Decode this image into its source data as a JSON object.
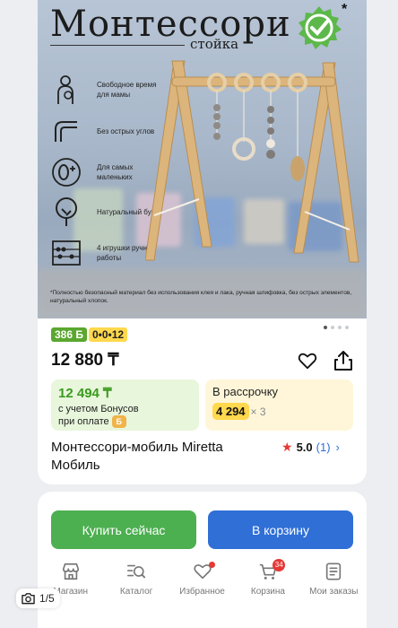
{
  "hero": {
    "brand": "Монтессори",
    "subtitle": "стойка",
    "seal_mark": "*",
    "features": [
      {
        "icon": "mother-child-icon",
        "text": "Свободное время для мамы"
      },
      {
        "icon": "rounded-corner-icon",
        "text": "Без острых углов"
      },
      {
        "icon": "zero-plus-icon",
        "text": "Для самых маленьких"
      },
      {
        "icon": "tree-icon",
        "text": "Натуральный бук"
      },
      {
        "icon": "abacus-icon",
        "text": "4 игрушки ручной работы"
      }
    ],
    "note": "*Полностью безопасный материал без использования клея и лака, ручная шлифовка, без острых элементов, натуральный хлопок."
  },
  "tags": {
    "bonus": "386 Б",
    "installment": "0•0•12"
  },
  "price": "12 880 ₸",
  "bonus_box": {
    "price": "12 494 ₸",
    "line1": "с учетом Бонусов",
    "line2": "при оплате",
    "coin": "Б"
  },
  "installment_box": {
    "title": "В рассрочку",
    "amount": "4 294",
    "times": "× 3"
  },
  "title": "Монтессори-мобиль Miretta Мобиль",
  "rating": {
    "score": "5.0",
    "count": "(1)"
  },
  "actions": {
    "buy_now": "Купить сейчас",
    "add_to_cart": "В корзину"
  },
  "tabbar": [
    {
      "label": "Магазин",
      "icon": "store-icon"
    },
    {
      "label": "Каталог",
      "icon": "catalog-search-icon"
    },
    {
      "label": "Избранное",
      "icon": "heart-icon"
    },
    {
      "label": "Корзина",
      "icon": "cart-icon",
      "badge": "34"
    },
    {
      "label": "Мои заказы",
      "icon": "orders-icon"
    }
  ],
  "gallery": {
    "counter": "1/5"
  },
  "colors": {
    "green": "#4caf50",
    "blue": "#2f6fd6",
    "red": "#e53935",
    "yellow": "#ffd84d"
  }
}
